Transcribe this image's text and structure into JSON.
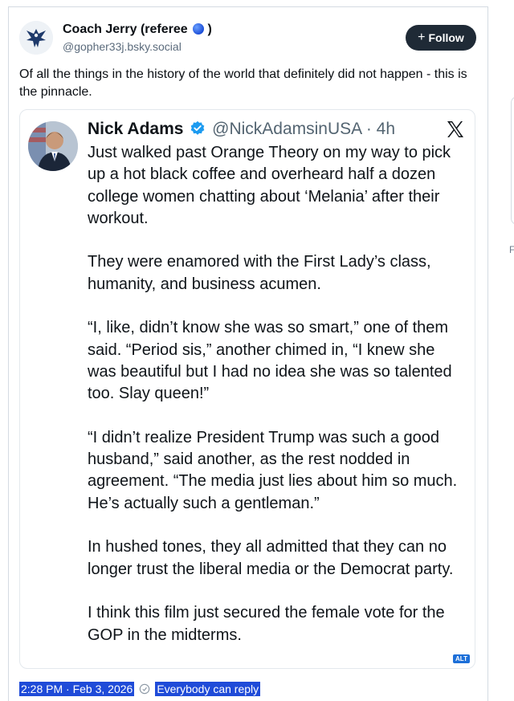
{
  "author": {
    "name": "Coach Jerry (referee",
    "name_suffix": ")",
    "handle": "@gopher33j.bsky.social"
  },
  "follow_label": "Follow",
  "post_text": "Of all the things in the history of the world that definitely did not happen - this is the pinnacle.",
  "embed": {
    "name": "Nick Adams",
    "handle": "@NickAdamsinUSA",
    "time": "4h",
    "body": "Just walked past Orange Theory on my way to pick up a hot black coffee and overheard half a dozen college women chatting about ‘Melania’ after their workout.\n\nThey were enamored with the First Lady’s class, humanity, and business acumen.\n\n“I, like, didn’t know she was so smart,” one of them said. “Period sis,” another chimed in, “I knew she was beautiful but I had no idea she was so talented too. Slay queen!”\n\n“I didn’t realize President Trump was such a good husband,” said another, as the rest nodded in agreement. “The media just lies about him so much. He’s actually such a gentleman.”\n\nIn hushed tones, they all admitted that they can no longer trust the liberal media or the Democrat party.\n\nI think this film just secured the female vote for the GOP in the midterms.",
    "alt_badge": "ALT"
  },
  "meta": {
    "timestamp": "2:28 PM · Feb 3, 2026",
    "reply_setting": "Everybody can reply"
  },
  "colors": {
    "follow_bg": "#1f2a36",
    "verified": "#1d9bf0",
    "selection": "#1f4bd8"
  }
}
